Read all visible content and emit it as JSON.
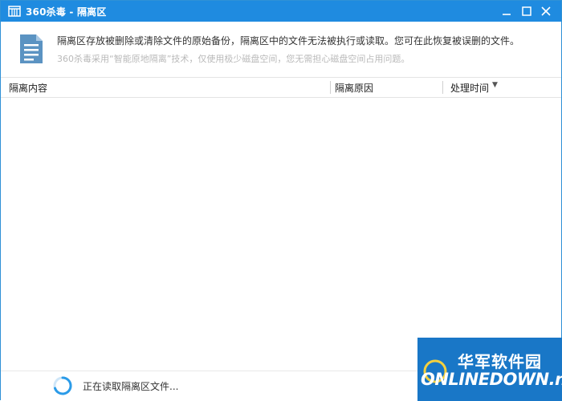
{
  "window": {
    "title": "360杀毒 - 隔离区"
  },
  "info": {
    "description": "隔离区存放被删除或清除文件的原始备份，隔离区中的文件无法被执行或读取。您可在此恢复被误删的文件。",
    "note": "360杀毒采用“智能原地隔离”技术，仅使用极少磁盘空间，您无需担心磁盘空间占用问题。"
  },
  "table": {
    "columns": [
      "隔离内容",
      "隔离原因",
      "处理时间"
    ],
    "rows": []
  },
  "status": {
    "text": "正在读取隔离区文件..."
  },
  "watermark": {
    "cn": "华军软件园",
    "en": "ONLINEDOWN.net"
  },
  "colors": {
    "titlebar": "#1f8be0",
    "watermark": "#1977c7",
    "spinner": "#2b9be8"
  },
  "icons": {
    "title": "quarantine-box-icon",
    "info": "document-icon",
    "status": "loading-spinner-icon"
  }
}
